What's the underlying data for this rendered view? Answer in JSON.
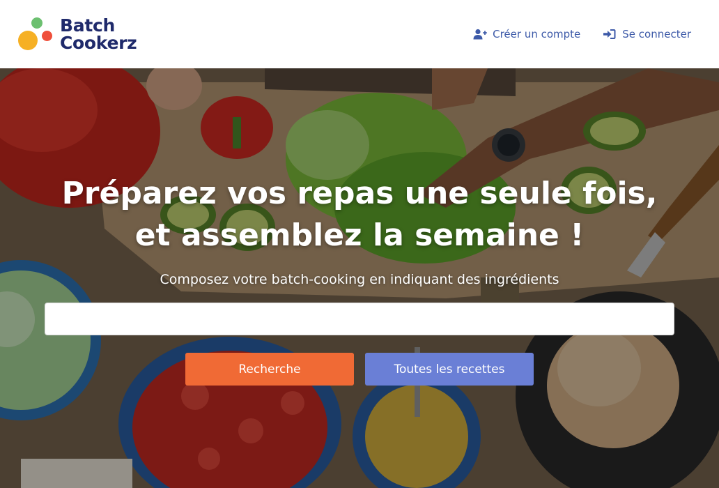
{
  "brand": {
    "line1": "Batch",
    "line2": "Cookerz",
    "colors": {
      "green": "#6cc070",
      "red": "#ef4f3a",
      "yellow": "#f6b024",
      "text": "#1f2a6b"
    }
  },
  "nav": {
    "signup_label": "Créer un compte",
    "signup_icon": "user-plus-icon",
    "login_label": "Se connecter",
    "login_icon": "sign-in-icon"
  },
  "hero": {
    "title_line1": "Préparez vos repas une seule fois,",
    "title_line2": "et assemblez la semaine !",
    "subtitle": "Composez votre batch-cooking en indiquant des ingrédients",
    "search_value": "",
    "search_label": "Recherche",
    "all_recipes_label": "Toutes les recettes"
  },
  "colors": {
    "link": "#3d5aa8",
    "search_button": "#f06a35",
    "all_recipes_button": "#6a7fd6"
  }
}
